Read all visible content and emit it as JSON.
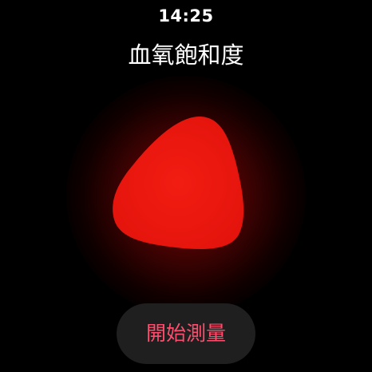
{
  "status_bar": {
    "time": "14:25"
  },
  "screen": {
    "title": "血氧飽和度"
  },
  "actions": {
    "start_label": "開始測量"
  },
  "colors": {
    "background": "#000000",
    "blob": "#ee1a10",
    "button_bg": "#1f1f1f",
    "button_text": "#ff4d6d"
  },
  "icons": {
    "center_graphic": "red-blob-animation"
  }
}
